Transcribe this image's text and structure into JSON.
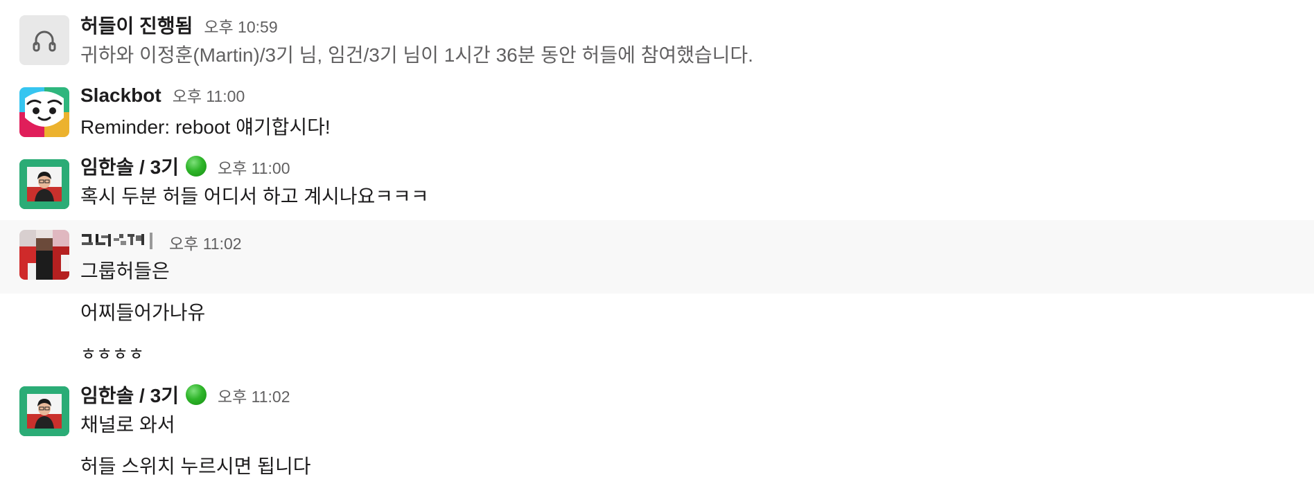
{
  "messages": {
    "huddle": {
      "title": "허들이 진행됨",
      "time": "오후 10:59",
      "text": "귀하와 이정훈(Martin)/3기 님, 임건/3기 님이 1시간 36분 동안 허들에 참여했습니다."
    },
    "slackbot": {
      "name": "Slackbot",
      "time": "오후 11:00",
      "text": "Reminder: reboot 얘기합시다!"
    },
    "hansol_1": {
      "name": "임한솔 / 3기",
      "time": "오후 11:00",
      "text": "혹시 두분 허들 어디서 하고 계시나요ㅋㅋㅋ"
    },
    "pixelated_user": {
      "time": "오후 11:02",
      "texts": [
        "그룹허들은",
        "어찌들어가나유",
        "ㅎㅎㅎㅎ"
      ]
    },
    "hansol_2": {
      "name": "임한솔 / 3기",
      "time": "오후 11:02",
      "texts": [
        "채널로 와서",
        "허들 스위치 누르시면 됩니다"
      ]
    }
  },
  "colors": {
    "status_green": "#2fb52a",
    "avatar_green": "#2bac76",
    "link_blue": "#1264a3",
    "hover_bg": "#f8f8f8"
  },
  "icons": {
    "huddle": "headphones-icon",
    "status": "green-circle-status-icon"
  }
}
